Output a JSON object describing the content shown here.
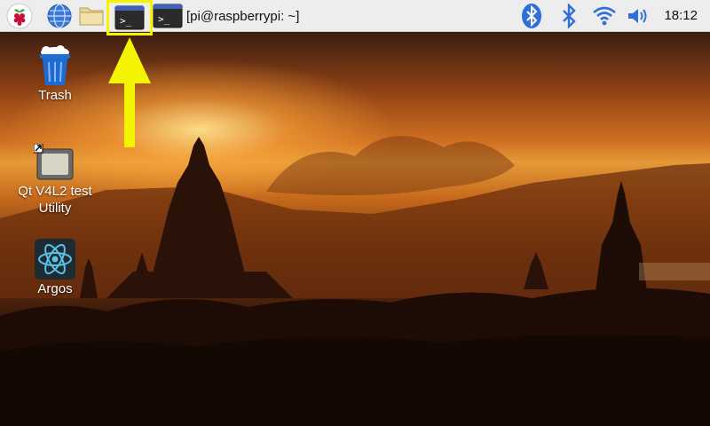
{
  "panel": {
    "task_label": "[pi@raspberrypi: ~]",
    "clock": "18:12",
    "icons": {
      "menu": "raspberry-icon",
      "browser": "globe-icon",
      "files": "folder-icon",
      "terminal": "terminal-icon",
      "bluetooth": "bluetooth-icon",
      "wifi": "wifi-icon",
      "volume": "volume-icon"
    }
  },
  "desktop": {
    "icons": [
      {
        "label": "Trash",
        "icon": "trash-icon"
      },
      {
        "label": "Qt V4L2 test Utility",
        "icon": "camera-icon"
      },
      {
        "label": "Argos",
        "icon": "atom-icon"
      }
    ]
  },
  "annotation": {
    "color": "#f4f400"
  },
  "colors": {
    "panel_bg": "#ededed",
    "accent_blue": "#2e6fd8"
  }
}
